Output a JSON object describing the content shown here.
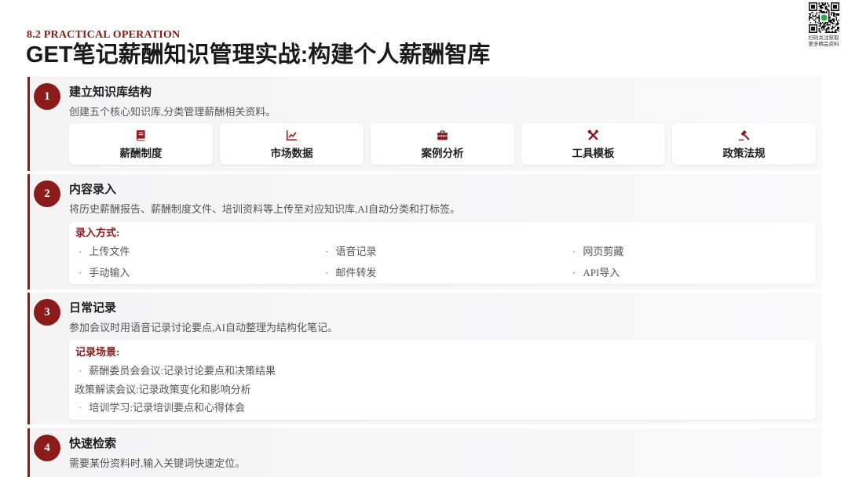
{
  "header": {
    "kicker": "8.2 PRACTICAL OPERATION",
    "title": "GET笔记薪酬知识管理实战:构建个人薪酬智库"
  },
  "qr": {
    "caption_line1": "扫码关注获取",
    "caption_line2": "更多精品资料"
  },
  "colors": {
    "accent": "#8b1a1a",
    "qr_logo": "#2fa84f"
  },
  "steps": [
    {
      "number": "1",
      "title": "建立知识库结构",
      "description": "创建五个核心知识库,分类管理薪酬相关资料。",
      "libraries": [
        {
          "label": "薪酬制度",
          "icon": "book-icon"
        },
        {
          "label": "市场数据",
          "icon": "chart-line-icon"
        },
        {
          "label": "案例分析",
          "icon": "briefcase-icon"
        },
        {
          "label": "工具模板",
          "icon": "tools-icon"
        },
        {
          "label": "政策法规",
          "icon": "gavel-icon"
        }
      ]
    },
    {
      "number": "2",
      "title": "内容录入",
      "description": "将历史薪酬报告、薪酬制度文件、培训资料等上传至对应知识库,AI自动分类和打标签。",
      "panel_label": "录入方式:",
      "methods": [
        "上传文件",
        "语音记录",
        "网页剪藏",
        "手动输入",
        "邮件转发",
        "API导入"
      ]
    },
    {
      "number": "3",
      "title": "日常记录",
      "description": "参加会议时用语音记录讨论要点,AI自动整理为结构化笔记。",
      "panel_label": "记录场景:",
      "scenes": [
        "薪酬委员会会议:记录讨论要点和决策结果",
        "政策解读会议:记录政策变化和影响分析",
        "培训学习:记录培训要点和心得体会"
      ]
    },
    {
      "number": "4",
      "title": "快速检索",
      "description": "需要某份资料时,输入关键词快速定位。"
    }
  ]
}
